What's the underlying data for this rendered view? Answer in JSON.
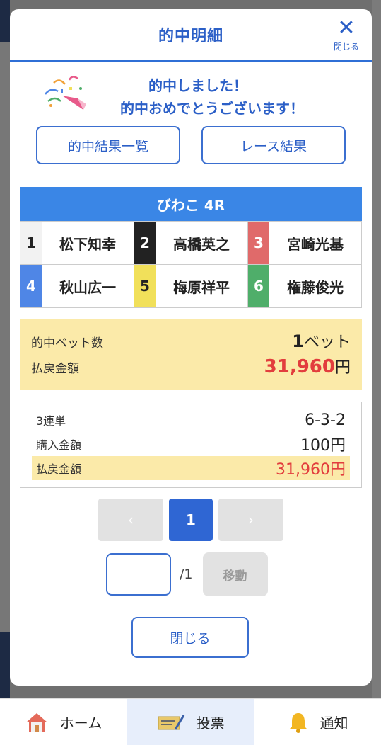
{
  "modal": {
    "title": "的中明細",
    "close_label": "閉じる"
  },
  "congrats": {
    "line1": "的中しました！",
    "line2": "的中おめでとうございます！"
  },
  "buttons": {
    "hit_list": "的中結果一覧",
    "race_result": "レース結果"
  },
  "race": {
    "name": "びわこ 4R",
    "racers": [
      {
        "num": "1",
        "name": "松下知幸",
        "bg": "#f2f2f2",
        "fg": "#222222"
      },
      {
        "num": "2",
        "name": "高橋英之",
        "bg": "#222222",
        "fg": "#ffffff"
      },
      {
        "num": "3",
        "name": "宮崎光基",
        "bg": "#e06a6a",
        "fg": "#ffffff"
      },
      {
        "num": "4",
        "name": "秋山広一",
        "bg": "#4f86e6",
        "fg": "#ffffff"
      },
      {
        "num": "5",
        "name": "梅原祥平",
        "bg": "#f1e05a",
        "fg": "#222222"
      },
      {
        "num": "6",
        "name": "権藤俊光",
        "bg": "#4fae6a",
        "fg": "#ffffff"
      }
    ]
  },
  "summary": {
    "bet_count_label": "的中ベット数",
    "bet_count": "1",
    "bet_unit": "ベット",
    "payout_label": "払戻金額",
    "payout": "31,960",
    "yen": "円"
  },
  "detail": {
    "type_label": "3連単",
    "combination": "6-3-2",
    "purchase_label": "購入金額",
    "purchase": "100円",
    "payout_label": "払戻金額",
    "payout": "31,960円"
  },
  "pager": {
    "prev": "‹",
    "current": "1",
    "next": "›",
    "input_value": "",
    "total": "/1",
    "move": "移動"
  },
  "close_button": "閉じる",
  "tabbar": {
    "home": "ホーム",
    "vote": "投票",
    "notify": "通知"
  },
  "colors": {
    "accent": "#2f66d3",
    "race_header": "#3a86e6",
    "highlight": "#fbeaa9",
    "payout_red": "#e23d3d"
  }
}
